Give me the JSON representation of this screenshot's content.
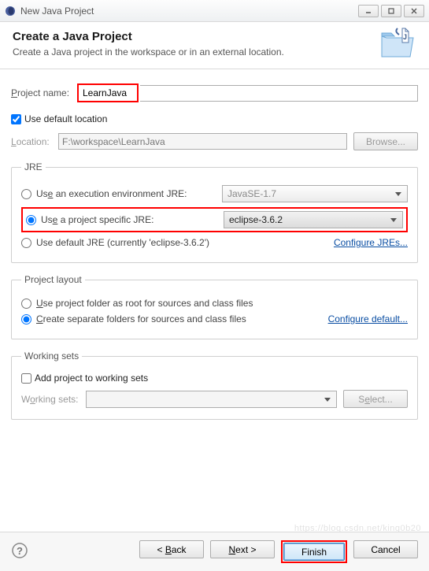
{
  "window": {
    "title": "New Java Project"
  },
  "banner": {
    "title": "Create a Java Project",
    "subtitle": "Create a Java project in the workspace or in an external location."
  },
  "projectName": {
    "label": "Project name:",
    "value": "LearnJava"
  },
  "useDefaultLocation": {
    "label": "Use default location",
    "checked": true
  },
  "location": {
    "label": "Location:",
    "value": "F:\\workspace\\LearnJava",
    "browse": "Browse..."
  },
  "jre": {
    "legend": "JRE",
    "opt1": {
      "label": "Use an execution environment JRE:",
      "value": "JavaSE-1.7"
    },
    "opt2": {
      "label": "Use a project specific JRE:",
      "value": "eclipse-3.6.2"
    },
    "opt3": {
      "label": "Use default JRE (currently 'eclipse-3.6.2')"
    },
    "configure": "Configure JREs..."
  },
  "layout": {
    "legend": "Project layout",
    "opt1": "Use project folder as root for sources and class files",
    "opt2": "Create separate folders for sources and class files",
    "configure": "Configure default..."
  },
  "workingSets": {
    "legend": "Working sets",
    "add": "Add project to working sets",
    "label": "Working sets:",
    "select": "Select..."
  },
  "buttons": {
    "back": "< Back",
    "next": "Next >",
    "finish": "Finish",
    "cancel": "Cancel"
  }
}
